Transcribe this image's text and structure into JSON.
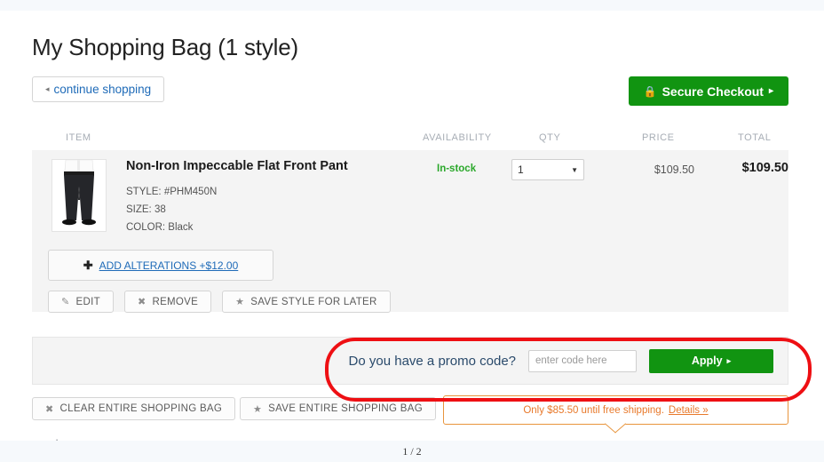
{
  "header": {
    "title": "My Shopping Bag (1 style)",
    "continue_shopping": "continue shopping",
    "continue_arrow": "◂",
    "checkout_label": "Secure Checkout",
    "checkout_lock": "🔒",
    "checkout_arrow": "▸",
    "checkout_color": "#119411"
  },
  "table": {
    "columns": {
      "item": "ITEM",
      "availability": "AVAILABILITY",
      "qty": "QTY",
      "price": "PRICE",
      "total": "TOTAL"
    }
  },
  "item": {
    "name": "Non-Iron Impeccable Flat Front Pant",
    "style": "STYLE: #PHM450N",
    "size": "SIZE: 38",
    "color": "COLOR: Black",
    "availability": "In-stock",
    "availability_color": "#2ba82b",
    "qty_value": "1",
    "qty_caret": "▼",
    "price": "$109.50",
    "total": "$109.50",
    "alterations_plus": "✚",
    "alterations_label": "ADD ALTERATIONS +$12.00",
    "actions": [
      {
        "icon": "✎",
        "icon_name": "pencil-icon",
        "label": "EDIT"
      },
      {
        "icon": "✖",
        "icon_name": "cross-icon",
        "label": "REMOVE"
      },
      {
        "icon": "★",
        "icon_name": "star-icon",
        "label": "SAVE STYLE FOR LATER"
      }
    ]
  },
  "promo": {
    "label": "Do you have a promo code?",
    "placeholder": "enter code here",
    "input_value": "",
    "apply_label": "Apply",
    "apply_arrow": "▸",
    "apply_color": "#119411",
    "annotation_color": "#ee0f13"
  },
  "bag_actions": {
    "clear_icon": "✖",
    "clear_label": "CLEAR ENTIRE SHOPPING BAG",
    "save_icon": "★",
    "save_label": "SAVE ENTIRE SHOPPING BAG"
  },
  "shipping_note": {
    "text": "Only $85.50 until free shipping.",
    "details_label": "Details »",
    "color": "#e8792b"
  },
  "footer": {
    "cutoff_text": "r www.google.com",
    "page_indicator": "1 / 2"
  }
}
